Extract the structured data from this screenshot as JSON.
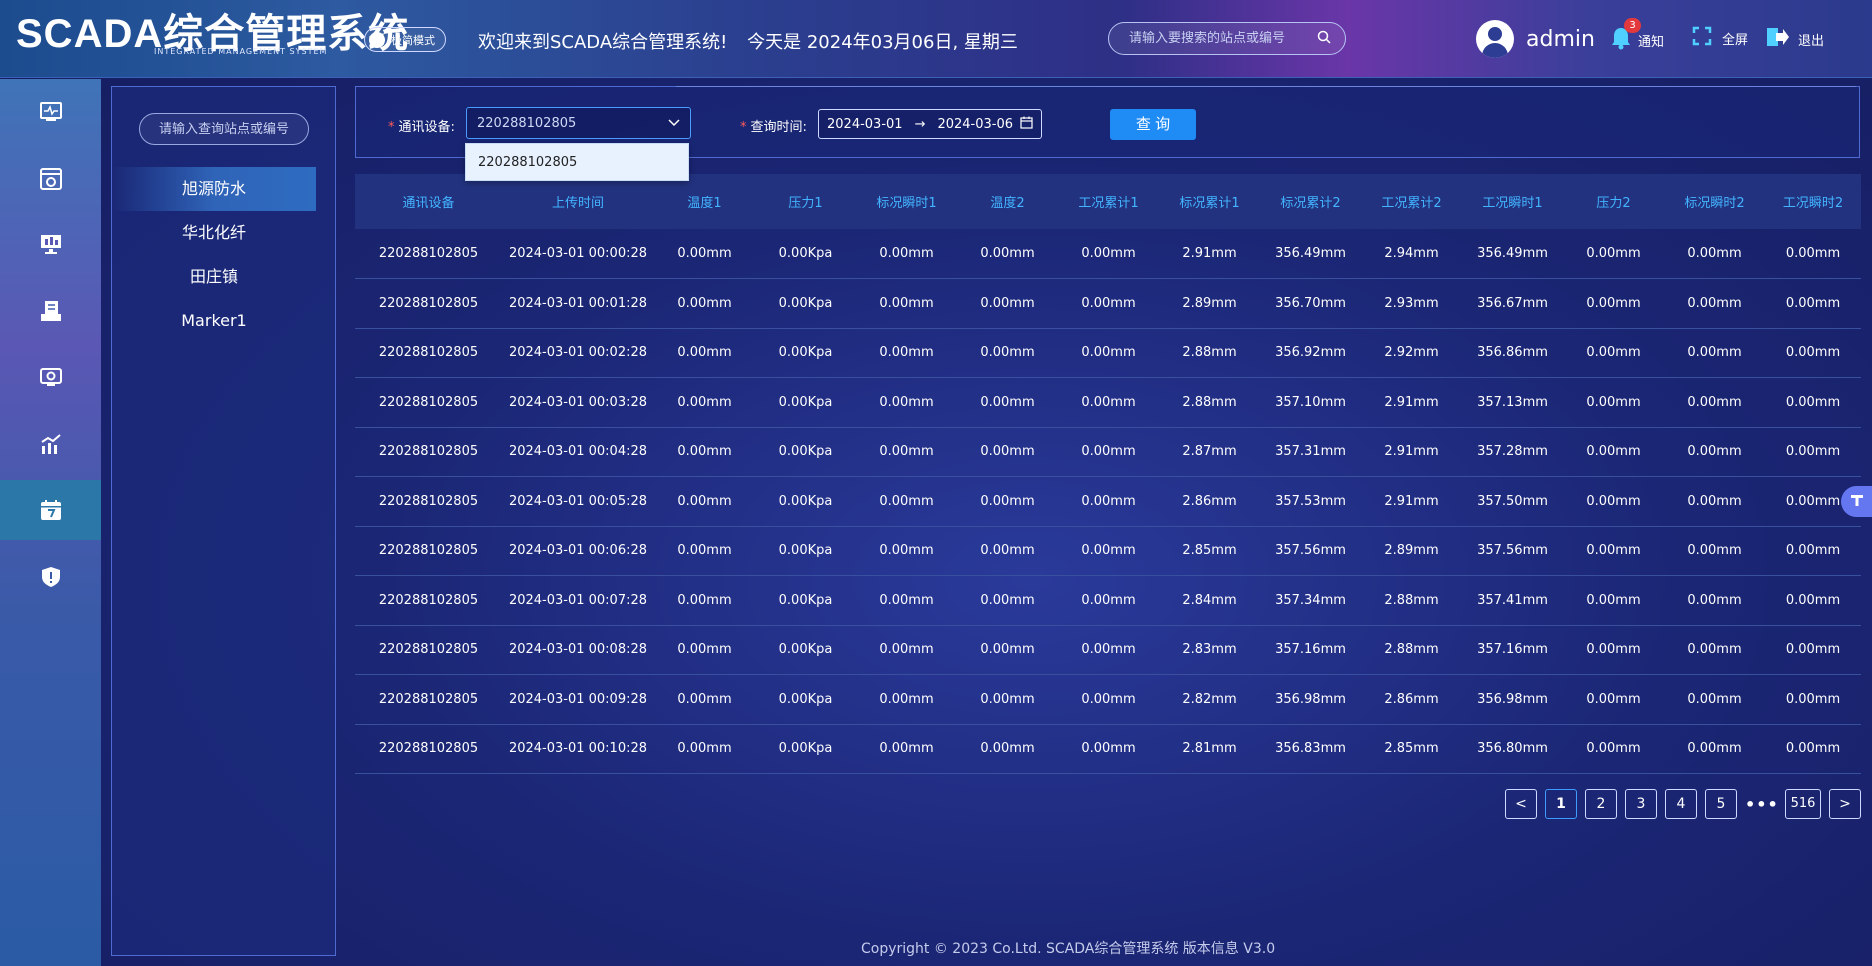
{
  "header": {
    "logo_main": "SCADA综合管理系统",
    "logo_sub": "INTEGRATED MANAGEMENT SYSTEM",
    "mode_toggle_label": "极简模式",
    "welcome": "欢迎来到SCADA综合管理系统!",
    "date_text": "今天是 2024年03月06日, 星期三",
    "search_placeholder": "请输入要搜索的站点或编号",
    "username": "admin",
    "notify_count": "3",
    "notify_label": "通知",
    "fullscreen_label": "全屏",
    "logout_label": "退出"
  },
  "sidebar_icons": [
    "monitor-icon",
    "dashboard-icon",
    "screen-icon",
    "report-icon",
    "video-icon",
    "chart-icon",
    "calendar-icon",
    "shield-icon"
  ],
  "stations": {
    "search_placeholder": "请输入查询站点或编号",
    "items": [
      "旭源防水",
      "华北化纤",
      "田庄镇",
      "Marker1"
    ]
  },
  "query": {
    "device_label": "通讯设备:",
    "device_value": "220288102805",
    "time_label": "查询时间:",
    "date_start": "2024-03-01",
    "date_sep": "→",
    "date_end": "2024-03-06",
    "query_button": "查 询",
    "dropdown_option": "220288102805"
  },
  "table": {
    "columns": [
      "通讯设备",
      "上传时间",
      "温度1",
      "压力1",
      "标况瞬时1",
      "温度2",
      "工况累计1",
      "标况累计1",
      "标况累计2",
      "工况累计2",
      "工况瞬时1",
      "压力2",
      "标况瞬时2",
      "工况瞬时2"
    ],
    "rows": [
      [
        "220288102805",
        "2024-03-01 00:00:28",
        "0.00mm",
        "0.00Kpa",
        "0.00mm",
        "0.00mm",
        "0.00mm",
        "2.91mm",
        "356.49mm",
        "2.94mm",
        "356.49mm",
        "0.00mm",
        "0.00mm",
        "0.00mm"
      ],
      [
        "220288102805",
        "2024-03-01 00:01:28",
        "0.00mm",
        "0.00Kpa",
        "0.00mm",
        "0.00mm",
        "0.00mm",
        "2.89mm",
        "356.70mm",
        "2.93mm",
        "356.67mm",
        "0.00mm",
        "0.00mm",
        "0.00mm"
      ],
      [
        "220288102805",
        "2024-03-01 00:02:28",
        "0.00mm",
        "0.00Kpa",
        "0.00mm",
        "0.00mm",
        "0.00mm",
        "2.88mm",
        "356.92mm",
        "2.92mm",
        "356.86mm",
        "0.00mm",
        "0.00mm",
        "0.00mm"
      ],
      [
        "220288102805",
        "2024-03-01 00:03:28",
        "0.00mm",
        "0.00Kpa",
        "0.00mm",
        "0.00mm",
        "0.00mm",
        "2.88mm",
        "357.10mm",
        "2.91mm",
        "357.13mm",
        "0.00mm",
        "0.00mm",
        "0.00mm"
      ],
      [
        "220288102805",
        "2024-03-01 00:04:28",
        "0.00mm",
        "0.00Kpa",
        "0.00mm",
        "0.00mm",
        "0.00mm",
        "2.87mm",
        "357.31mm",
        "2.91mm",
        "357.28mm",
        "0.00mm",
        "0.00mm",
        "0.00mm"
      ],
      [
        "220288102805",
        "2024-03-01 00:05:28",
        "0.00mm",
        "0.00Kpa",
        "0.00mm",
        "0.00mm",
        "0.00mm",
        "2.86mm",
        "357.53mm",
        "2.91mm",
        "357.50mm",
        "0.00mm",
        "0.00mm",
        "0.00mm"
      ],
      [
        "220288102805",
        "2024-03-01 00:06:28",
        "0.00mm",
        "0.00Kpa",
        "0.00mm",
        "0.00mm",
        "0.00mm",
        "2.85mm",
        "357.56mm",
        "2.89mm",
        "357.56mm",
        "0.00mm",
        "0.00mm",
        "0.00mm"
      ],
      [
        "220288102805",
        "2024-03-01 00:07:28",
        "0.00mm",
        "0.00Kpa",
        "0.00mm",
        "0.00mm",
        "0.00mm",
        "2.84mm",
        "357.34mm",
        "2.88mm",
        "357.41mm",
        "0.00mm",
        "0.00mm",
        "0.00mm"
      ],
      [
        "220288102805",
        "2024-03-01 00:08:28",
        "0.00mm",
        "0.00Kpa",
        "0.00mm",
        "0.00mm",
        "0.00mm",
        "2.83mm",
        "357.16mm",
        "2.88mm",
        "357.16mm",
        "0.00mm",
        "0.00mm",
        "0.00mm"
      ],
      [
        "220288102805",
        "2024-03-01 00:09:28",
        "0.00mm",
        "0.00Kpa",
        "0.00mm",
        "0.00mm",
        "0.00mm",
        "2.82mm",
        "356.98mm",
        "2.86mm",
        "356.98mm",
        "0.00mm",
        "0.00mm",
        "0.00mm"
      ],
      [
        "220288102805",
        "2024-03-01 00:10:28",
        "0.00mm",
        "0.00Kpa",
        "0.00mm",
        "0.00mm",
        "0.00mm",
        "2.81mm",
        "356.83mm",
        "2.85mm",
        "356.80mm",
        "0.00mm",
        "0.00mm",
        "0.00mm"
      ]
    ]
  },
  "pagination": {
    "prev": "<",
    "pages": [
      "1",
      "2",
      "3",
      "4",
      "5"
    ],
    "ellipsis": "•••",
    "last": "516",
    "next": ">",
    "current": "1"
  },
  "footer": "Copyright © 2023 Co.Ltd. SCADA综合管理系统 版本信息 V3.0",
  "colors": {
    "accent": "#1f8bf5",
    "header_text": "#43b4ff",
    "badge": "#e4393c"
  }
}
